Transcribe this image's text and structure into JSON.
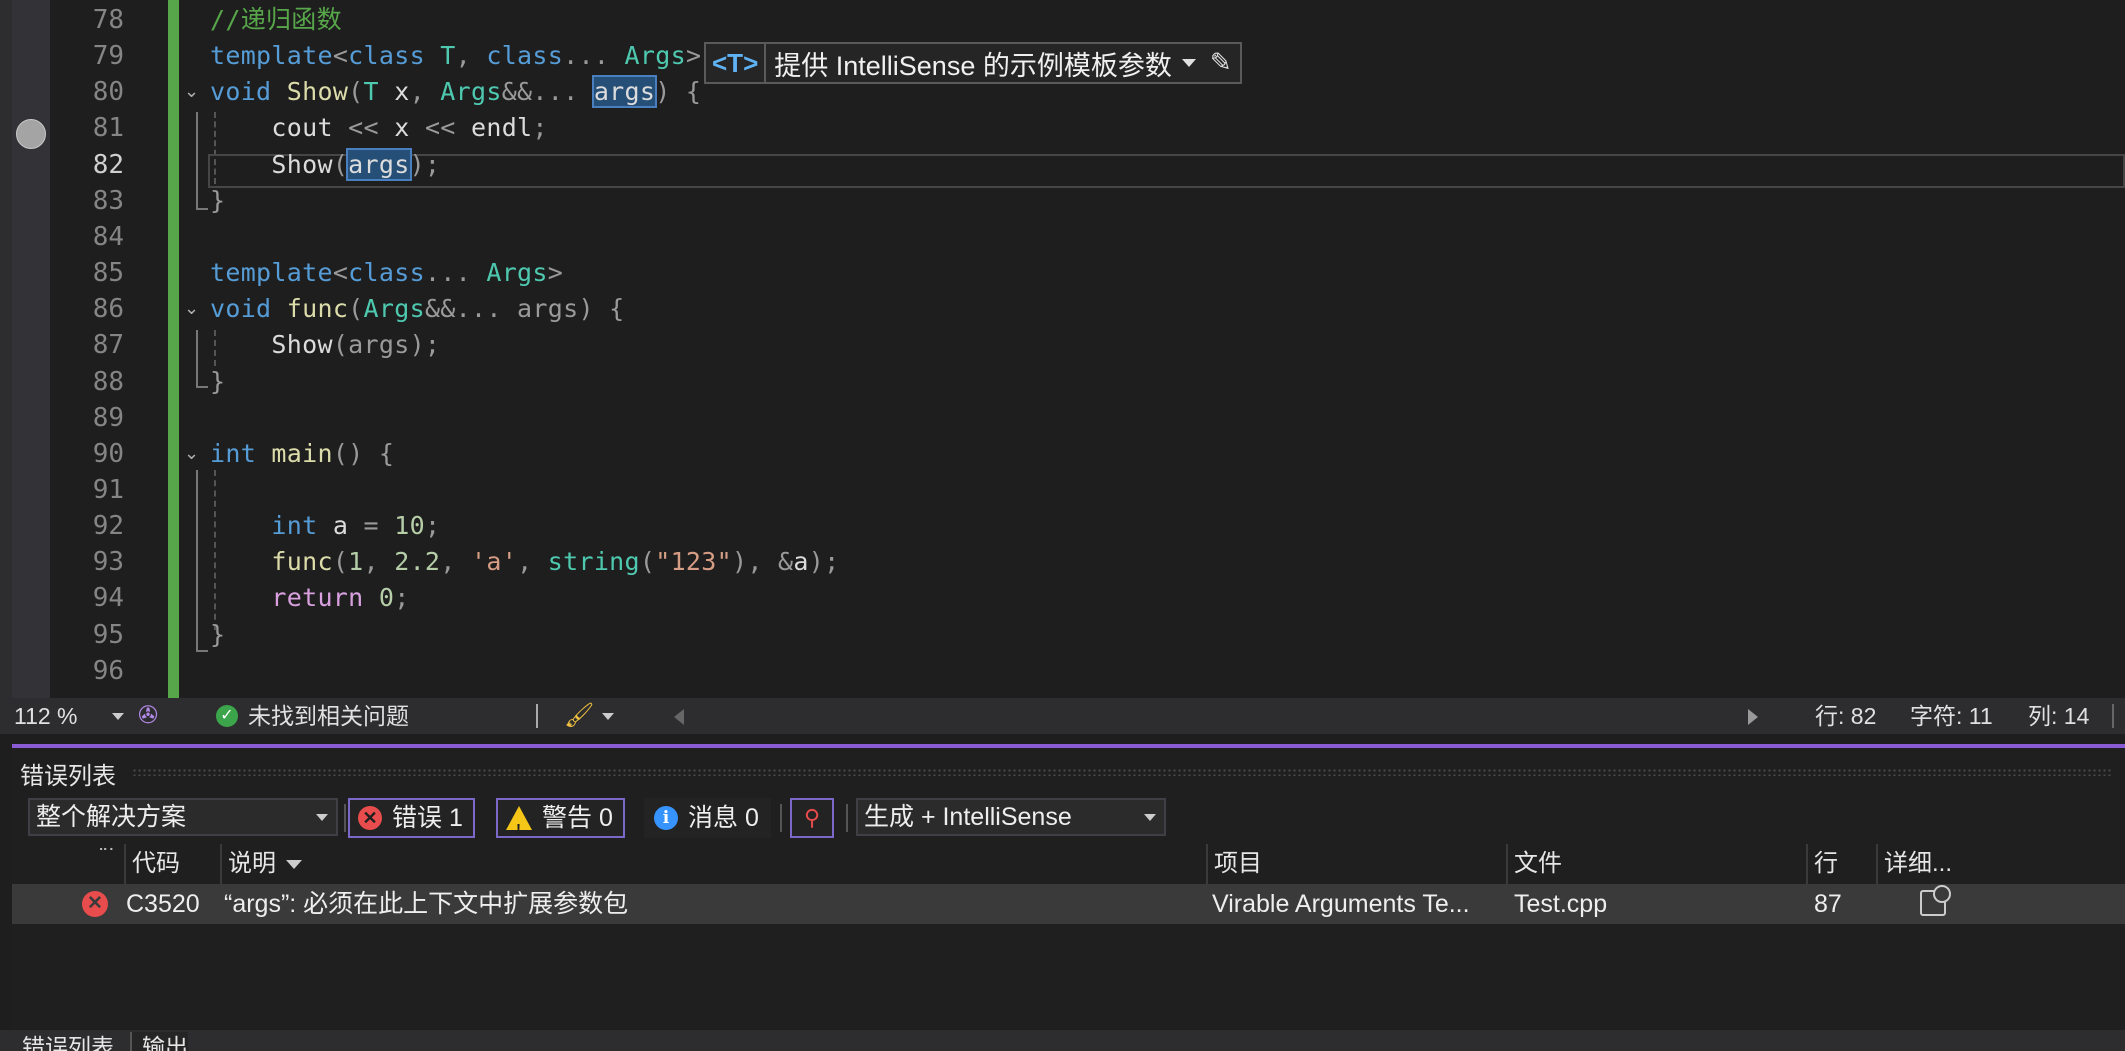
{
  "editor": {
    "lines": [
      {
        "num": "78",
        "tokens": [
          [
            "c",
            "//递归函数"
          ]
        ]
      },
      {
        "num": "79",
        "tokens": [
          [
            "k",
            "template"
          ],
          [
            "p",
            "<"
          ],
          [
            "k",
            "class"
          ],
          [
            "v",
            " "
          ],
          [
            "t",
            "T"
          ],
          [
            "p",
            ", "
          ],
          [
            "k",
            "class"
          ],
          [
            "p",
            "... "
          ],
          [
            "t",
            "Args"
          ],
          [
            "p",
            ">"
          ]
        ]
      },
      {
        "num": "80",
        "fold": true,
        "tokens": [
          [
            "k",
            "void"
          ],
          [
            "v",
            " "
          ],
          [
            "f",
            "Show"
          ],
          [
            "p",
            "("
          ],
          [
            "t",
            "T"
          ],
          [
            "v",
            " x"
          ],
          [
            "p",
            ", "
          ],
          [
            "t",
            "Args"
          ],
          [
            "p",
            "&&... "
          ],
          [
            "hl",
            "args"
          ],
          [
            "p",
            ") {"
          ]
        ]
      },
      {
        "num": "81",
        "tokens": [
          [
            "v",
            "    cout "
          ],
          [
            "p",
            "<<"
          ],
          [
            "v",
            " x "
          ],
          [
            "p",
            "<<"
          ],
          [
            "v",
            " endl"
          ],
          [
            "p",
            ";"
          ]
        ]
      },
      {
        "num": "82",
        "current": true,
        "tokens": [
          [
            "v",
            "    "
          ],
          [
            "v",
            "Show"
          ],
          [
            "p",
            "("
          ],
          [
            "hl",
            "args"
          ],
          [
            "p",
            ");"
          ]
        ]
      },
      {
        "num": "83",
        "tokens": [
          [
            "p",
            "}"
          ]
        ]
      },
      {
        "num": "84",
        "tokens": []
      },
      {
        "num": "85",
        "tokens": [
          [
            "k",
            "template"
          ],
          [
            "p",
            "<"
          ],
          [
            "k",
            "class"
          ],
          [
            "p",
            "... "
          ],
          [
            "t",
            "Args"
          ],
          [
            "p",
            ">"
          ]
        ]
      },
      {
        "num": "86",
        "fold": true,
        "tokens": [
          [
            "k",
            "void"
          ],
          [
            "v",
            " "
          ],
          [
            "f",
            "func"
          ],
          [
            "p",
            "("
          ],
          [
            "t",
            "Args"
          ],
          [
            "p",
            "&&... "
          ],
          [
            "p",
            "args"
          ],
          [
            "p",
            ") {"
          ]
        ]
      },
      {
        "num": "87",
        "tokens": [
          [
            "v",
            "    "
          ],
          [
            "v",
            "Show"
          ],
          [
            "p",
            "("
          ],
          [
            "p",
            "args"
          ],
          [
            "p",
            ");"
          ]
        ]
      },
      {
        "num": "88",
        "tokens": [
          [
            "p",
            "}"
          ]
        ]
      },
      {
        "num": "89",
        "tokens": []
      },
      {
        "num": "90",
        "fold": true,
        "tokens": [
          [
            "k",
            "int"
          ],
          [
            "v",
            " "
          ],
          [
            "f",
            "main"
          ],
          [
            "p",
            "() {"
          ]
        ]
      },
      {
        "num": "91",
        "tokens": []
      },
      {
        "num": "92",
        "tokens": [
          [
            "v",
            "    "
          ],
          [
            "k",
            "int"
          ],
          [
            "v",
            " a "
          ],
          [
            "p",
            "="
          ],
          [
            "v",
            " "
          ],
          [
            "n",
            "10"
          ],
          [
            "p",
            ";"
          ]
        ]
      },
      {
        "num": "93",
        "tokens": [
          [
            "v",
            "    "
          ],
          [
            "f",
            "func"
          ],
          [
            "p",
            "("
          ],
          [
            "n",
            "1"
          ],
          [
            "p",
            ", "
          ],
          [
            "n",
            "2.2"
          ],
          [
            "p",
            ", "
          ],
          [
            "s",
            "'a'"
          ],
          [
            "p",
            ", "
          ],
          [
            "t",
            "string"
          ],
          [
            "p",
            "("
          ],
          [
            "s",
            "\"123\""
          ],
          [
            "p",
            "), &"
          ],
          [
            "v",
            "a"
          ],
          [
            "p",
            ");"
          ]
        ]
      },
      {
        "num": "94",
        "tokens": [
          [
            "v",
            "    "
          ],
          [
            "r",
            "return"
          ],
          [
            "v",
            " "
          ],
          [
            "n",
            "0"
          ],
          [
            "p",
            ";"
          ]
        ]
      },
      {
        "num": "95",
        "tokens": [
          [
            "p",
            "}"
          ]
        ]
      },
      {
        "num": "96",
        "tokens": []
      }
    ],
    "intellisense": {
      "tag": "<T>",
      "text": "提供 IntelliSense 的示例模板参数"
    }
  },
  "status": {
    "zoom": "112 %",
    "issues": "未找到相关问题",
    "row": "行: 82",
    "char": "字符: 11",
    "col": "列: 14"
  },
  "error_list": {
    "title": "错误列表",
    "scope": "整个解决方案",
    "errors_label": "错误 1",
    "warnings_label": "警告 0",
    "messages_label": "消息 0",
    "source": "生成 + IntelliSense",
    "columns": {
      "code": "代码",
      "description": "说明",
      "project": "项目",
      "file": "文件",
      "line": "行",
      "details": "详细..."
    },
    "rows": [
      {
        "code": "C3520",
        "description": "“args”: 必须在此上下文中扩展参数包",
        "project": "Virable  Arguments Te...",
        "file": "Test.cpp",
        "line": "87"
      }
    ]
  },
  "bottom_tabs": [
    "错误列表",
    "输出"
  ],
  "colors": {
    "accent": "#8b5bd6",
    "error": "#e84c4c",
    "warning": "#f5c518",
    "info": "#3794ff",
    "change_bar": "#57a64a"
  }
}
